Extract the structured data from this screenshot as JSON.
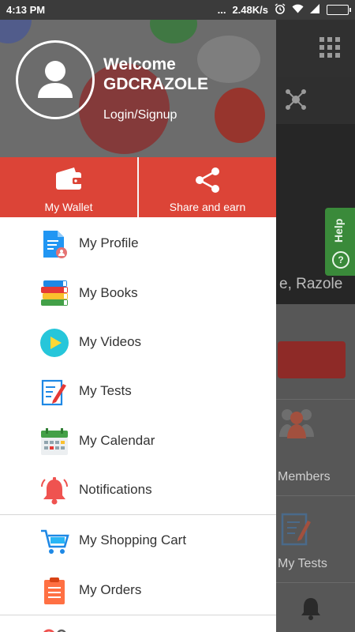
{
  "status_bar": {
    "time": "4:13 PM",
    "network_speed": "2.48K/s",
    "dots": "...",
    "icons": [
      "alarm-icon",
      "wifi-icon",
      "signal-icon",
      "battery-icon"
    ]
  },
  "background_app": {
    "banner_text": "e, Razole",
    "members_label": "Members",
    "tests_label": "My Tests",
    "help_label": "Help",
    "help_icon_glyph": "?"
  },
  "drawer": {
    "header": {
      "welcome": "Welcome",
      "username": "GDCRAZOLE",
      "login_link": "Login/Signup"
    },
    "actions": [
      {
        "label": "My Wallet",
        "icon": "wallet-icon"
      },
      {
        "label": "Share and earn",
        "icon": "share-icon"
      }
    ],
    "menu": [
      {
        "label": "My Profile",
        "icon": "profile-document-icon"
      },
      {
        "label": "My Books",
        "icon": "books-icon"
      },
      {
        "label": "My Videos",
        "icon": "play-video-icon"
      },
      {
        "label": "My Tests",
        "icon": "test-pencil-icon"
      },
      {
        "label": "My Calendar",
        "icon": "calendar-icon"
      },
      {
        "label": "Notifications",
        "icon": "bell-icon"
      },
      {
        "label": "My Shopping Cart",
        "icon": "shopping-cart-icon"
      },
      {
        "label": "My Orders",
        "icon": "orders-clipboard-icon"
      }
    ]
  },
  "colors": {
    "accent_red": "#dc4437",
    "header_gray": "#6c6c6c",
    "help_green": "#3a8a3a"
  }
}
